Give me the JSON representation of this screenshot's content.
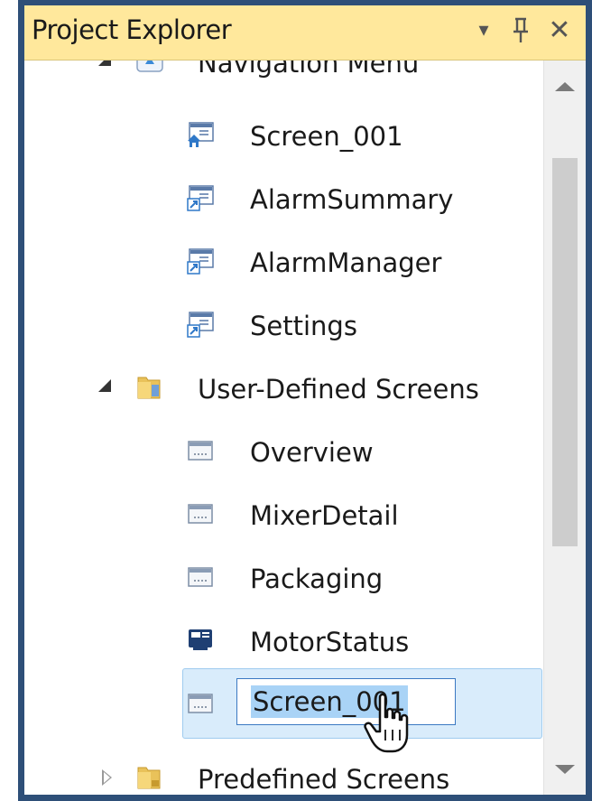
{
  "panel": {
    "title": "Project Explorer",
    "dropdown_glyph": "▾",
    "pin_glyph": "ᴾ",
    "close_glyph": "✕"
  },
  "tree": {
    "items": [
      {
        "label": "Navigation Menu",
        "icon": "navigation-menu-icon",
        "expanded": true
      },
      {
        "label": "Screen_001",
        "icon": "home-screen-icon"
      },
      {
        "label": "AlarmSummary",
        "icon": "screen-link-icon"
      },
      {
        "label": "AlarmManager",
        "icon": "screen-link-icon"
      },
      {
        "label": "Settings",
        "icon": "screen-link-icon"
      },
      {
        "label": "User-Defined Screens",
        "icon": "folder-icon",
        "expanded": true
      },
      {
        "label": "Overview",
        "icon": "screen-icon"
      },
      {
        "label": "MixerDetail",
        "icon": "screen-icon"
      },
      {
        "label": "Packaging",
        "icon": "screen-icon"
      },
      {
        "label": "MotorStatus",
        "icon": "faceplate-screen-icon"
      },
      {
        "label": "Screen_001",
        "icon": "screen-icon",
        "editing": true
      },
      {
        "label": "Predefined Screens",
        "icon": "folder-icon",
        "expanded": false
      }
    ]
  },
  "colors": {
    "title_bg": "#ffe89c",
    "selection_bg": "#d9ecfb",
    "edit_selection": "#a9d3f6",
    "frame": "#2e4f78"
  }
}
